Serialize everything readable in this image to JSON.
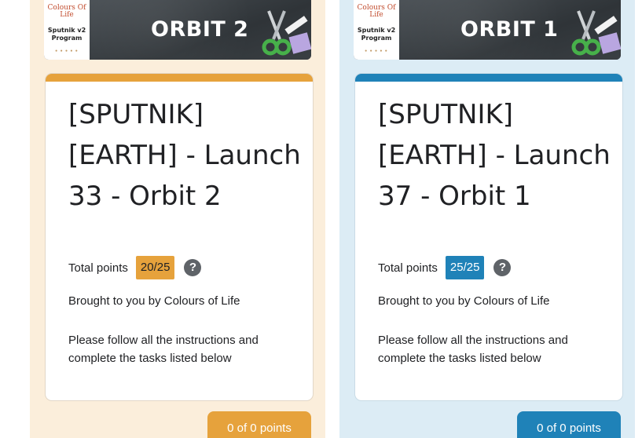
{
  "left": {
    "logo_text": "Colours Of Life",
    "program": "Sputnik v2 Program",
    "banner_title": "ORBIT 2",
    "title": "[SPUTNIK] [EARTH] - Launch 33 - Orbit 2",
    "points_label": "Total points",
    "points_value": "20/25",
    "brought": "Brought to you by Colours of Life",
    "instructions": "Please follow all the instructions and complete the tasks listed below",
    "score_button": "0 of 0 points",
    "accent": "#e6a23c"
  },
  "right": {
    "logo_text": "Colours Of Life",
    "program": "Sputnik v2 Program",
    "banner_title": "ORBIT 1",
    "title": "[SPUTNIK] [EARTH] - Launch 37 - Orbit 1",
    "points_label": "Total points",
    "points_value": "25/25",
    "brought": "Brought to you by Colours of Life",
    "instructions": "Please follow all the instructions and complete the tasks listed below",
    "score_button": "0 of 0 points",
    "accent": "#1f82b8"
  },
  "icons": {
    "help": "?",
    "help_name": "help-icon",
    "banner_art": "scissors-icon"
  }
}
